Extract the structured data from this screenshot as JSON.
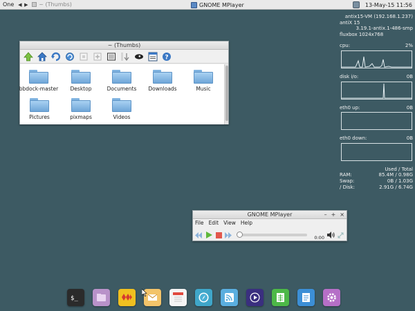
{
  "taskbar": {
    "workspace": "One",
    "inactive_task": "~ (Thumbs)",
    "active_task": "GNOME MPlayer",
    "clock": "13-May-15 11:56"
  },
  "file_window": {
    "title": "~ (Thumbs)",
    "items": [
      {
        "label": "bbdock-master"
      },
      {
        "label": "Desktop"
      },
      {
        "label": "Documents"
      },
      {
        "label": "Downloads"
      },
      {
        "label": "Music"
      },
      {
        "label": "Pictures"
      },
      {
        "label": "pixmaps"
      },
      {
        "label": "Videos"
      }
    ]
  },
  "conky": {
    "host_line": "antix15-VM (192.168.1.237)",
    "distro": "antiX 15",
    "kernel": "3.19.1-antix.1-486-smp",
    "wm": "fluxbox 1024x768",
    "cpu_label": "cpu:",
    "cpu_value": "2%",
    "disk_label": "disk i/o:",
    "disk_value": "0B",
    "eth_up_label": "eth0 up:",
    "eth_up_value": "0B",
    "eth_down_label": "eth0 down:",
    "eth_down_value": "0B",
    "mem_header": "Used / Total",
    "mem_rows": [
      {
        "label": "RAM:",
        "value": "85.4M  / 0.98G"
      },
      {
        "label": "Swap:",
        "value": "0B   / 1.03G"
      },
      {
        "label": "/ Disk:",
        "value": "2.91G  / 6.74G"
      }
    ]
  },
  "mplayer": {
    "title": "GNOME MPlayer",
    "win_buttons": {
      "minimize": "–",
      "maximize": "+",
      "close": "×"
    },
    "menu": [
      "File",
      "Edit",
      "View",
      "Help"
    ],
    "time": "0:00",
    "progress": 0
  },
  "dock": {
    "items": [
      {
        "icon": "terminal-icon",
        "color": "#2b2b2b"
      },
      {
        "icon": "file-manager-icon",
        "color": "#b892c9"
      },
      {
        "icon": "image-viewer-icon",
        "color": "#f0c020"
      },
      {
        "icon": "mail-icon",
        "color": "#f3c46a"
      },
      {
        "icon": "calendar-icon",
        "color": "#f4f4f4"
      },
      {
        "icon": "web-browser-icon",
        "color": "#3fa6c9"
      },
      {
        "icon": "rss-reader-icon",
        "color": "#5aaedf"
      },
      {
        "icon": "media-player-icon",
        "color": "#3a2f7f"
      },
      {
        "icon": "spreadsheet-icon",
        "color": "#4db848"
      },
      {
        "icon": "text-editor-icon",
        "color": "#3c8fd6"
      },
      {
        "icon": "settings-icon",
        "color": "#b56fc7"
      }
    ]
  }
}
